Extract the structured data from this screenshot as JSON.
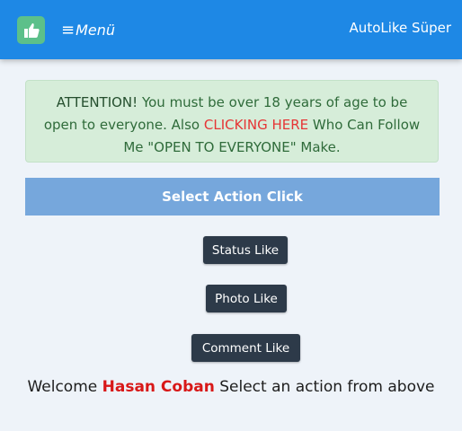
{
  "navbar": {
    "logo_icon": "thumbs-up-icon",
    "menu_icon": "hamburger-icon",
    "menu_label": "Menü",
    "brand": "AutoLike Süper",
    "color": "#1e88e5"
  },
  "alert": {
    "strong": "ATTENTION!",
    "text_1": " You must be over 18 years of age to be open to everyone. Also ",
    "link": "CLICKING HERE",
    "text_2": " Who Can Follow Me \"OPEN TO EVERYONE\" Make."
  },
  "banner": {
    "label": "Select Action Click"
  },
  "actions": {
    "status": "Status Like",
    "photo": "Photo Like",
    "comment": "Comment Like"
  },
  "welcome": {
    "prefix": "Welcome ",
    "name": "Hasan Coban",
    "suffix": " Select an action from above"
  }
}
